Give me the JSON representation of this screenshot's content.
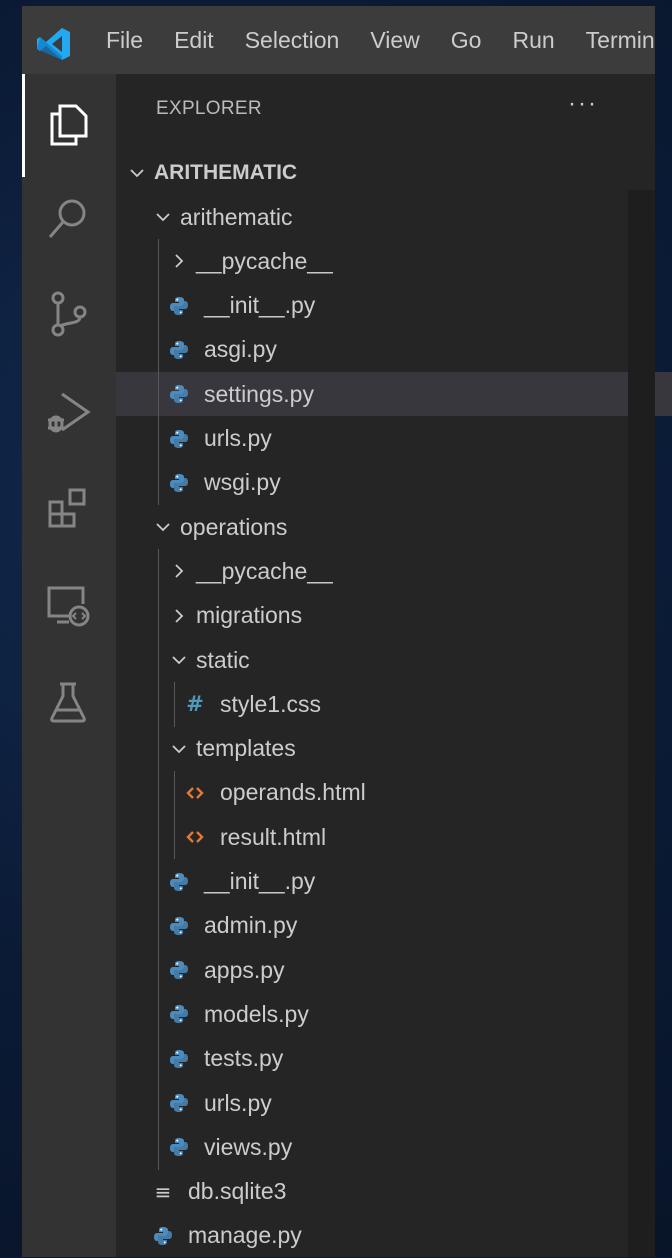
{
  "menu": {
    "items": [
      "File",
      "Edit",
      "Selection",
      "View",
      "Go",
      "Run",
      "Terminal"
    ]
  },
  "activity_bar": {
    "icons": [
      "explorer-icon",
      "search-icon",
      "source-control-icon",
      "run-debug-icon",
      "extensions-icon",
      "remote-explorer-icon",
      "testing-icon"
    ],
    "active": "explorer-icon"
  },
  "explorer": {
    "header": "EXPLORER",
    "more_actions": "···",
    "root": "ARITHEMATIC"
  },
  "tree": [
    {
      "label": "arithematic",
      "type": "folder",
      "expanded": true,
      "depth": 1
    },
    {
      "label": "__pycache__",
      "type": "folder",
      "expanded": false,
      "depth": 2
    },
    {
      "label": "__init__.py",
      "type": "python",
      "depth": 2
    },
    {
      "label": "asgi.py",
      "type": "python",
      "depth": 2
    },
    {
      "label": "settings.py",
      "type": "python",
      "depth": 2,
      "selected": true
    },
    {
      "label": "urls.py",
      "type": "python",
      "depth": 2
    },
    {
      "label": "wsgi.py",
      "type": "python",
      "depth": 2
    },
    {
      "label": "operations",
      "type": "folder",
      "expanded": true,
      "depth": 1
    },
    {
      "label": "__pycache__",
      "type": "folder",
      "expanded": false,
      "depth": 2
    },
    {
      "label": "migrations",
      "type": "folder",
      "expanded": false,
      "depth": 2
    },
    {
      "label": "static",
      "type": "folder",
      "expanded": true,
      "depth": 2
    },
    {
      "label": "style1.css",
      "type": "css",
      "depth": 3
    },
    {
      "label": "templates",
      "type": "folder",
      "expanded": true,
      "depth": 2
    },
    {
      "label": "operands.html",
      "type": "html",
      "depth": 3
    },
    {
      "label": "result.html",
      "type": "html",
      "depth": 3
    },
    {
      "label": "__init__.py",
      "type": "python",
      "depth": 2
    },
    {
      "label": "admin.py",
      "type": "python",
      "depth": 2
    },
    {
      "label": "apps.py",
      "type": "python",
      "depth": 2
    },
    {
      "label": "models.py",
      "type": "python",
      "depth": 2
    },
    {
      "label": "tests.py",
      "type": "python",
      "depth": 2
    },
    {
      "label": "urls.py",
      "type": "python",
      "depth": 2
    },
    {
      "label": "views.py",
      "type": "python",
      "depth": 2
    },
    {
      "label": "db.sqlite3",
      "type": "text",
      "depth": 1
    },
    {
      "label": "manage.py",
      "type": "python",
      "depth": 1
    }
  ],
  "colors": {
    "python_icon": "#4b8bbe",
    "python_icon_yellow": "#f0d26b",
    "html_icon": "#e37933",
    "css_icon": "#519aba",
    "selected_row": "#37373d"
  }
}
